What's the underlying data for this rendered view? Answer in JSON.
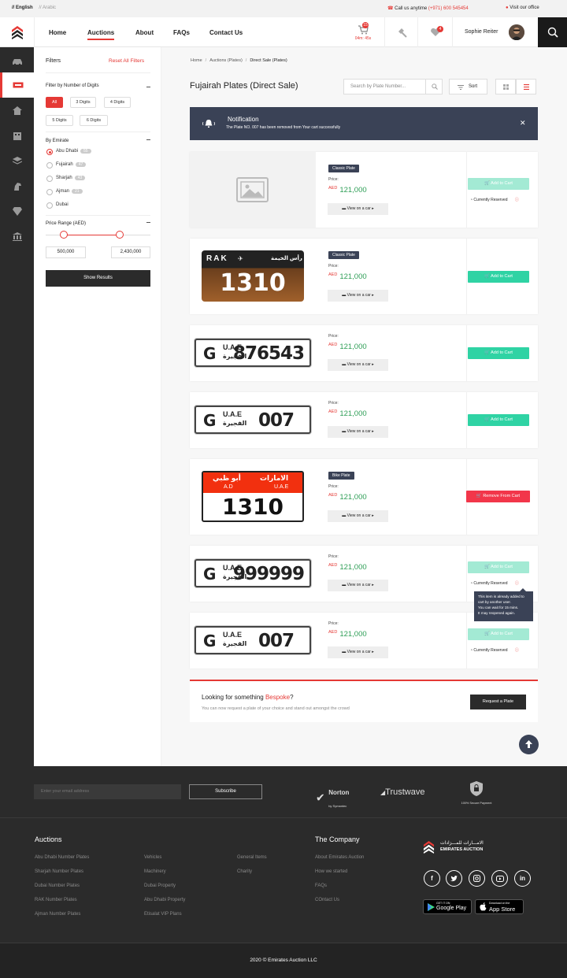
{
  "topbar": {
    "lang_en": "// English",
    "lang_ar": "// Arabic",
    "call_label": "Call us anytime",
    "call_number": "(+971) 600 545454",
    "visit_label": "Visit our office"
  },
  "nav": {
    "home": "Home",
    "auctions": "Auctions",
    "about": "About",
    "faqs": "FAQs",
    "contact": "Contact Us"
  },
  "header": {
    "cart_count": "15",
    "cart_timer": "04m: 45s",
    "fav_count": "4",
    "user_name": "Sophie Reiter"
  },
  "filters": {
    "title": "Filters",
    "reset": "Reset All Filters",
    "digits_title": "Filter by Number of Digits",
    "digits": [
      "All",
      "3 Digits",
      "4 Digits",
      "5 Digits",
      "6 Digits"
    ],
    "emirate_title": "By Emirate",
    "emirates": [
      {
        "name": "Abu Dhabi",
        "count": "55"
      },
      {
        "name": "Fujairah",
        "count": "47"
      },
      {
        "name": "Sharjah",
        "count": "43"
      },
      {
        "name": "Ajman",
        "count": "21"
      },
      {
        "name": "Dubai",
        "count": ""
      }
    ],
    "price_title": "Price Range (AED)",
    "price_min": "500,000",
    "price_max": "2,430,000",
    "show_results": "Show Results"
  },
  "breadcrumb": [
    "Home",
    "Auctions (Plates)",
    "Direct Sale (Plates)"
  ],
  "page_title": "Fujairah Plates (Direct Sale)",
  "search_placeholder": "Search by Plate Number...",
  "sort_label": "Sort",
  "notification": {
    "title": "Notification",
    "text": "The Plate NO. 007 has been removed from Your cart successfully"
  },
  "common": {
    "price_label": "Price:",
    "currency": "AED",
    "view_on_car": "View on a car",
    "reserved": "Currently Reserved",
    "add_to_cart": "Add to Cart",
    "remove_from_cart": "Remove From Cart"
  },
  "listings": [
    {
      "tag": "Classic Plate",
      "price": "121,000",
      "action": "Add to Cart",
      "state": "reserved"
    },
    {
      "tag": "Classic Plate",
      "price": "121,000",
      "action": "Add to Cart",
      "state": "available",
      "plate": {
        "emirate_en": "RAK",
        "emirate_ar": "رأس الخيمة",
        "number": "1310"
      }
    },
    {
      "tag": "",
      "price": "121,000",
      "action": "Add to Cart",
      "state": "available",
      "plate": {
        "code": "G",
        "country": "U.A.E",
        "emirate_ar": "الفجيرة",
        "number": "876543"
      }
    },
    {
      "tag": "",
      "price": "121,000",
      "action": "Add to Cart",
      "state": "available",
      "plate": {
        "code": "G",
        "country": "U.A.E",
        "emirate_ar": "الفجيرة",
        "number": "007"
      }
    },
    {
      "tag": "Bike Plate",
      "price": "121,000",
      "action": "Remove From Cart",
      "state": "in-cart",
      "plate": {
        "top_left": "أبو ظبي",
        "top_right": "الامارات",
        "ad": "A.D",
        "uae": "U.A.E",
        "number": "1310"
      }
    },
    {
      "tag": "",
      "price": "121,000",
      "action": "Add to Cart",
      "state": "reserved",
      "plate": {
        "code": "G",
        "country": "U.A.E",
        "emirate_ar": "الفجيرة",
        "number": "999999"
      }
    },
    {
      "tag": "",
      "price": "121,000",
      "action": "Add to Cart",
      "state": "reserved",
      "plate": {
        "code": "G",
        "country": "U.A.E",
        "emirate_ar": "الفجيرة",
        "number": "007"
      }
    }
  ],
  "tooltip": {
    "line1": "This item is already added to",
    "line2": "cart by another user.",
    "line3": "You can wait for 15 mins.",
    "line4": "It may reopened again."
  },
  "bespoke": {
    "title_pre": "Looking for something ",
    "title_hl": "Bespoke",
    "title_post": "?",
    "text": "You can now request a plate of your choice and stand out amongst the crowd",
    "button": "Request a Plate"
  },
  "footer": {
    "email_placeholder": "Enter your email address",
    "subscribe": "Subscribe",
    "norton": "Norton",
    "norton_sub": "by Symantec",
    "trustwave": "Trustwave",
    "secure": "100% Secure Payment",
    "auctions_title": "Auctions",
    "col1": [
      "Abu Dhabi Number Plates",
      "Sharjah Number Plates",
      "Dubai Number Plates",
      "RAK Number Plates",
      "Ajman Number Plates"
    ],
    "col2": [
      "Vehicles",
      "Machinery",
      "Dubai Property",
      "Abu Dhabi Property",
      "Etisalat VIP Plans"
    ],
    "col3": [
      "General Items",
      "Charity"
    ],
    "company_title": "The Company",
    "col4": [
      "About Emirates Auction",
      "How we started",
      "FAQs",
      "COntact Us"
    ],
    "brand_ar": "الامـــارات للمـــزادات",
    "brand_en": "EMIRATES AUCTION",
    "gplay_small": "GET IT ON",
    "gplay": "Google Play",
    "appstore_small": "Download on the",
    "appstore": "App Store",
    "copyright": "2020 © Emirates Auction LLC"
  },
  "colors": {
    "accent": "#e53935",
    "navy": "#3a4256",
    "green": "#2fd3a4",
    "price_green": "#2e9e56"
  }
}
